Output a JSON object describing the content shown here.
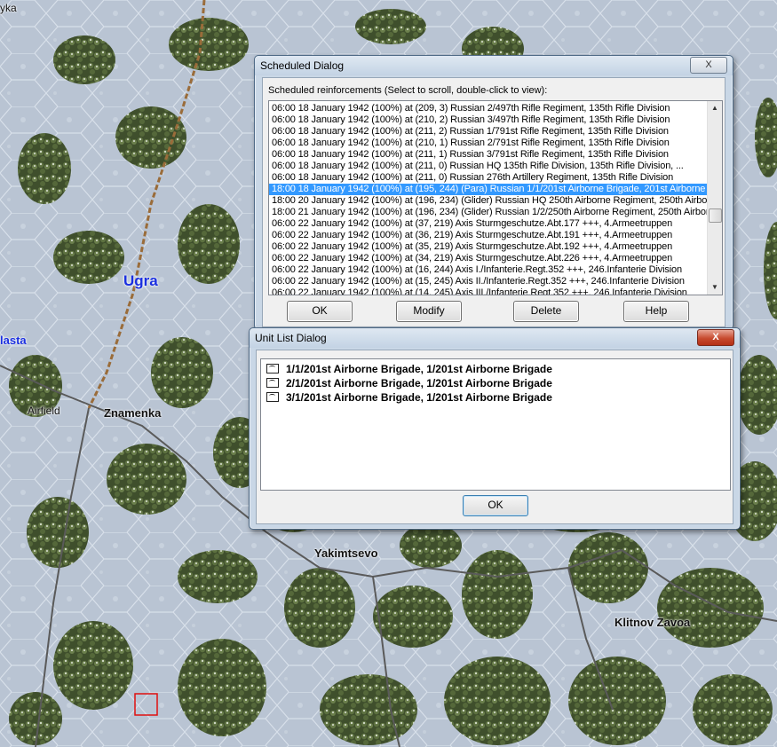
{
  "map": {
    "labels": {
      "top_left": "yka",
      "river": "Ugra",
      "nastasia": "lasta",
      "airfield": "Airfield",
      "znamenka": "Znamenka",
      "yakimtsevo": "Yakimtsevo",
      "klitnov": "Klitnov Zavoa"
    }
  },
  "scheduled_dialog": {
    "title": "Scheduled Dialog",
    "close_label": "X",
    "instruction": "Scheduled reinforcements (Select to scroll, double-click to view):",
    "rows": [
      "06:00 18 January 1942 (100%) at (209, 3) Russian 2/497th Rifle Regiment, 135th Rifle Division",
      "06:00 18 January 1942 (100%) at (210, 2) Russian 3/497th Rifle Regiment, 135th Rifle Division",
      "06:00 18 January 1942 (100%) at (211, 2) Russian 1/791st Rifle Regiment, 135th Rifle Division",
      "06:00 18 January 1942 (100%) at (210, 1) Russian 2/791st Rifle Regiment, 135th Rifle Division",
      "06:00 18 January 1942 (100%) at (211, 1) Russian 3/791st Rifle Regiment, 135th Rifle Division",
      "06:00 18 January 1942 (100%) at (211, 0) Russian HQ 135th Rifle Division, 135th Rifle Division, ...",
      "06:00 18 January 1942 (100%) at (211, 0) Russian 276th Artillery Regiment, 135th Rifle Division",
      "18:00 18 January 1942 (100%) at (195, 244) (Para) Russian 1/1/201st Airborne Brigade, 201st Airborne B",
      "18:00 20 January 1942 (100%) at (196, 234) (Glider) Russian HQ 250th Airborne Regiment, 250th Airborn",
      "18:00 21 January 1942 (100%) at (196, 234) (Glider) Russian 1/2/250th Airborne Regiment, 250th Airbor",
      "06:00 22 January 1942 (100%) at (37, 219) Axis Sturmgeschutze.Abt.177 +++, 4.Armeetruppen",
      "06:00 22 January 1942 (100%) at (36, 219) Axis Sturmgeschutze.Abt.191 +++, 4.Armeetruppen",
      "06:00 22 January 1942 (100%) at (35, 219) Axis Sturmgeschutze.Abt.192 +++, 4.Armeetruppen",
      "06:00 22 January 1942 (100%) at (34, 219) Axis Sturmgeschutze.Abt.226 +++, 4.Armeetruppen",
      "06:00 22 January 1942 (100%) at (16, 244) Axis I./Infanterie.Regt.352 +++, 246.Infanterie Division",
      "06:00 22 January 1942 (100%) at (15, 245) Axis II./Infanterie.Regt.352 +++, 246.Infanterie Division",
      "06:00 22 January 1942 (100%) at (14, 245) Axis III./Infanterie.Regt.352 +++, 246.Infanterie Division"
    ],
    "selected_index": 7,
    "scroll_fraction": 0.62,
    "buttons": {
      "ok": "OK",
      "modify": "Modify",
      "delete": "Delete",
      "help": "Help"
    }
  },
  "unit_list_dialog": {
    "title": "Unit List Dialog",
    "close_label": "X",
    "units": [
      "1/1/201st Airborne Brigade, 1/201st Airborne Brigade",
      "2/1/201st Airborne Brigade, 1/201st Airborne Brigade",
      "3/1/201st Airborne Brigade, 1/201st Airborne Brigade"
    ],
    "ok_label": "OK"
  },
  "colors": {
    "selection": "#3399ff",
    "cursor_box": "#e01010",
    "river_label": "#1a2fe0"
  }
}
